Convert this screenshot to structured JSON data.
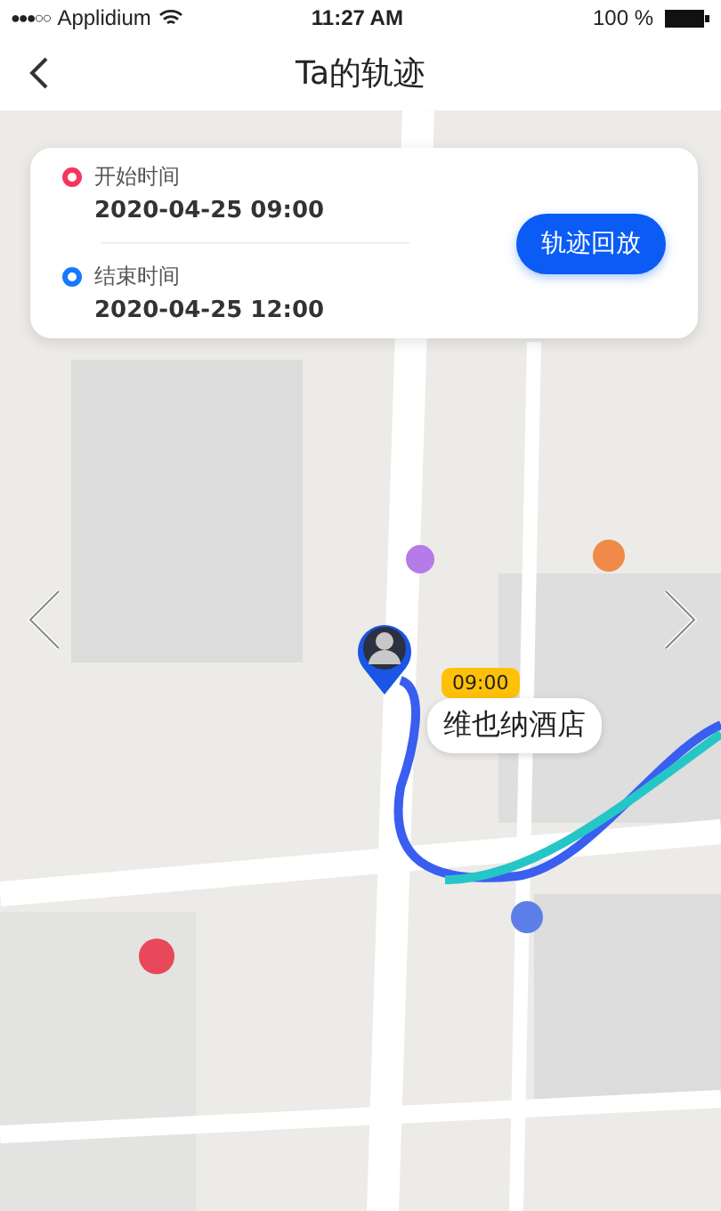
{
  "status_bar": {
    "signal": "●●●○○",
    "carrier": "Applidium",
    "time": "11:27 AM",
    "battery": "100 %"
  },
  "nav": {
    "title": "Ta的轨迹"
  },
  "track_card": {
    "points": [
      {
        "label": "开始时间",
        "time": "2020-04-25 09:00",
        "color": "#f5365c"
      },
      {
        "label": "结束时间",
        "time": "2020-04-25 12:00",
        "color": "#1677ff"
      }
    ],
    "button": "轨迹回放"
  },
  "marker": {
    "time": "09:00",
    "place": "维也纳酒店"
  }
}
